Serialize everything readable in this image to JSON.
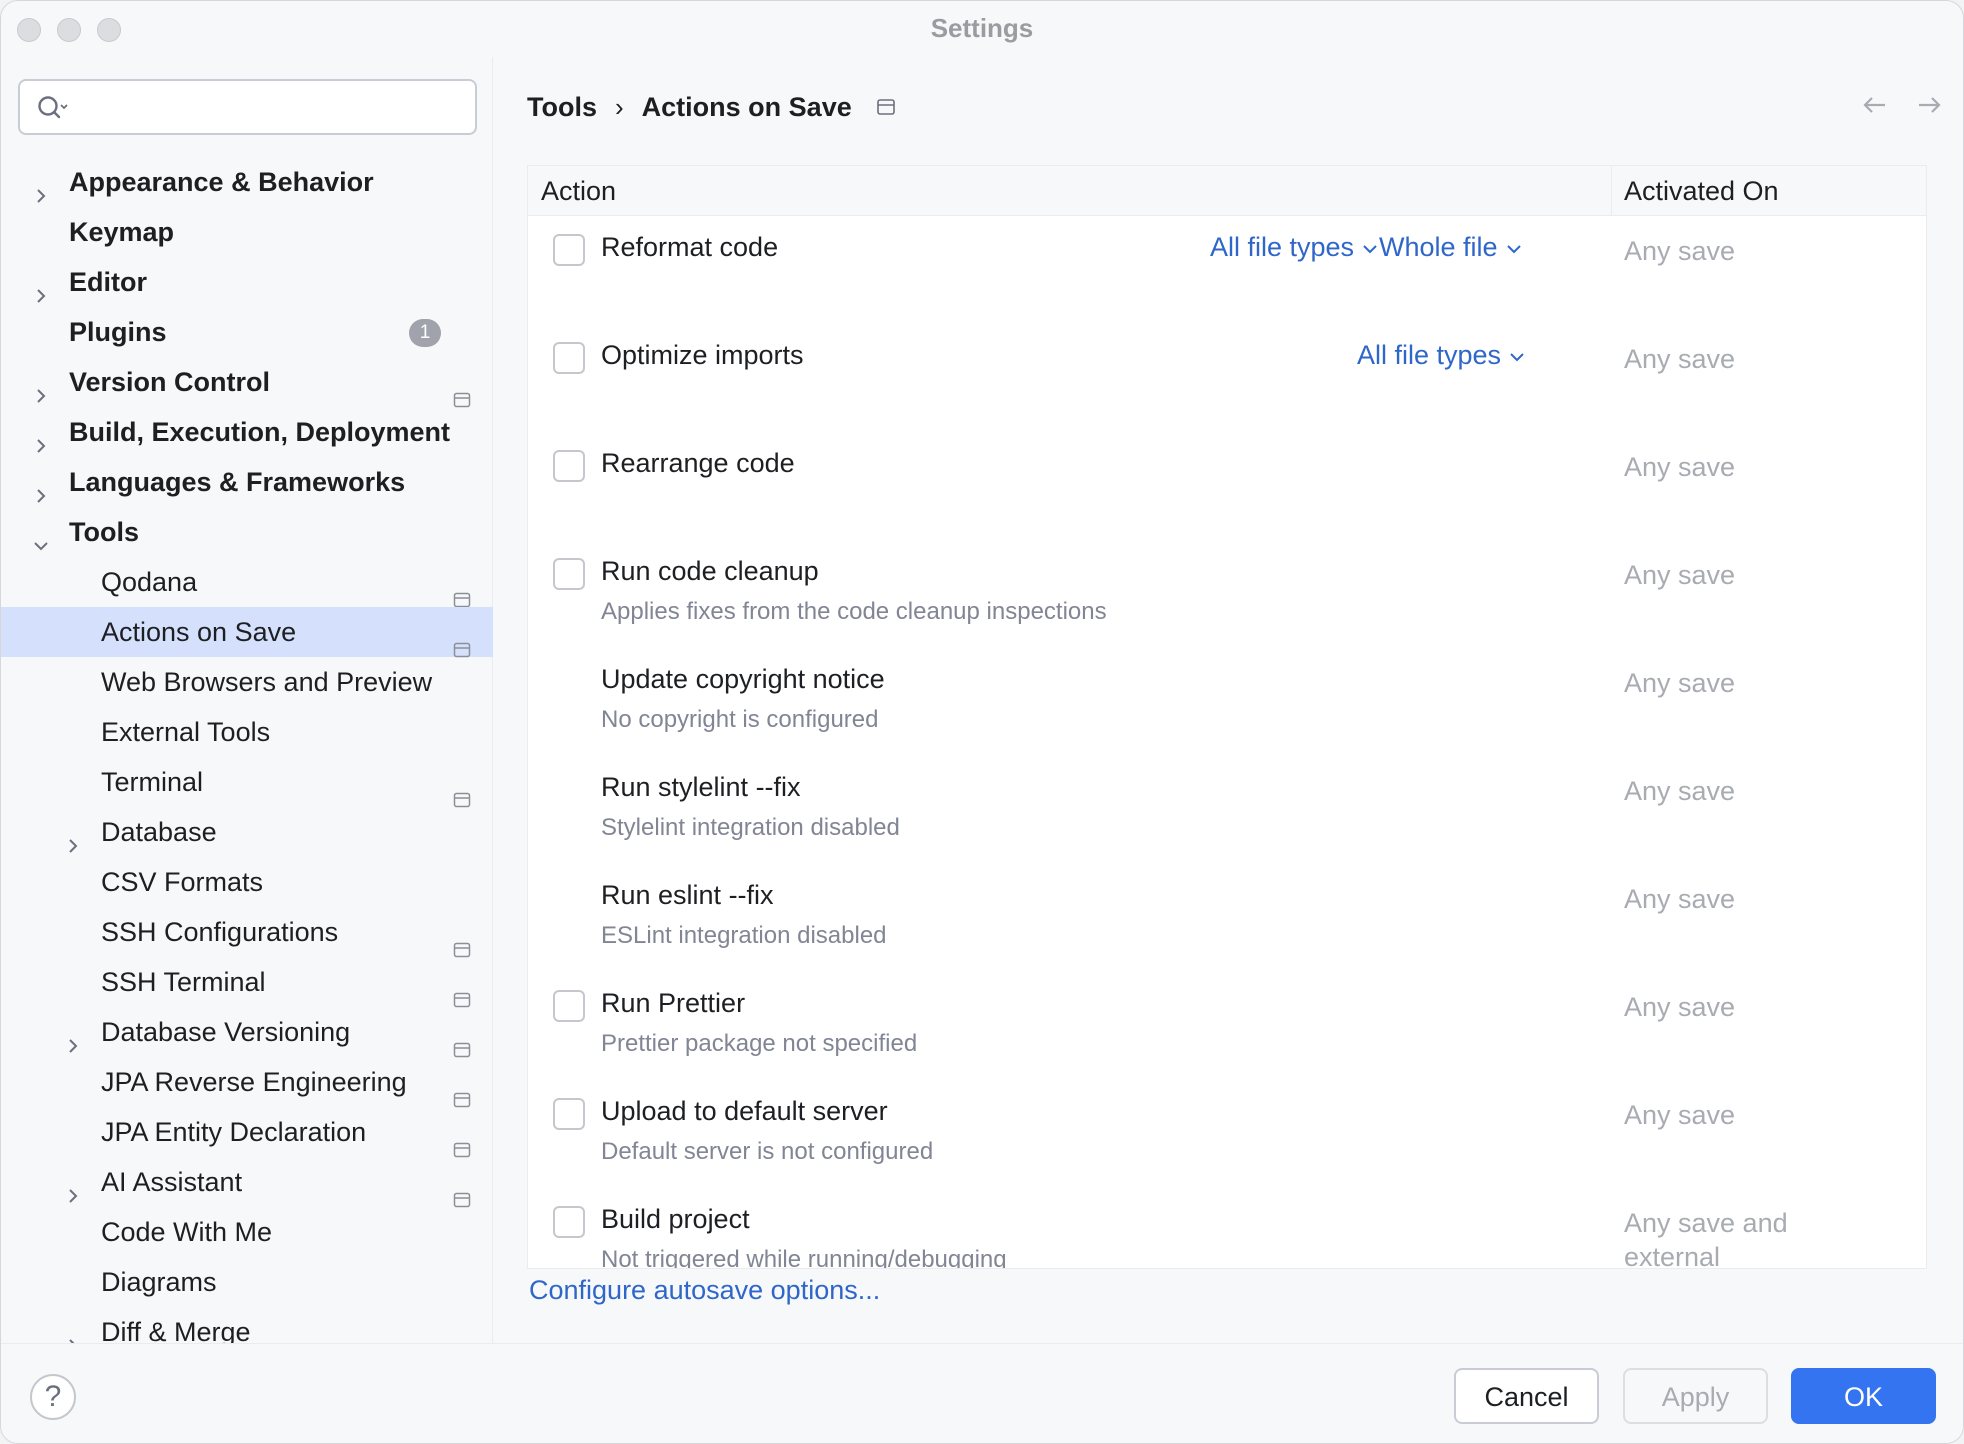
{
  "window": {
    "title": "Settings"
  },
  "search": {
    "placeholder": "",
    "value": ""
  },
  "sidebar": {
    "items": [
      {
        "label": "Appearance & Behavior",
        "level": 0,
        "expandable": true,
        "expanded": false
      },
      {
        "label": "Keymap",
        "level": 0,
        "expandable": false
      },
      {
        "label": "Editor",
        "level": 0,
        "expandable": true,
        "expanded": false
      },
      {
        "label": "Plugins",
        "level": 0,
        "expandable": false,
        "badge": "1"
      },
      {
        "label": "Version Control",
        "level": 0,
        "expandable": true,
        "expanded": false,
        "project_icon": true
      },
      {
        "label": "Build, Execution, Deployment",
        "level": 0,
        "expandable": true,
        "expanded": false
      },
      {
        "label": "Languages & Frameworks",
        "level": 0,
        "expandable": true,
        "expanded": false
      },
      {
        "label": "Tools",
        "level": 0,
        "expandable": true,
        "expanded": true
      },
      {
        "label": "Qodana",
        "level": 1,
        "project_icon": true
      },
      {
        "label": "Actions on Save",
        "level": 1,
        "project_icon": true,
        "selected": true
      },
      {
        "label": "Web Browsers and Preview",
        "level": 1
      },
      {
        "label": "External Tools",
        "level": 1
      },
      {
        "label": "Terminal",
        "level": 1,
        "project_icon": true
      },
      {
        "label": "Database",
        "level": 1,
        "expandable": true
      },
      {
        "label": "CSV Formats",
        "level": 1
      },
      {
        "label": "SSH Configurations",
        "level": 1,
        "project_icon": true
      },
      {
        "label": "SSH Terminal",
        "level": 1,
        "project_icon": true
      },
      {
        "label": "Database Versioning",
        "level": 1,
        "expandable": true,
        "project_icon": true
      },
      {
        "label": "JPA Reverse Engineering",
        "level": 1,
        "project_icon": true
      },
      {
        "label": "JPA Entity Declaration",
        "level": 1,
        "project_icon": true
      },
      {
        "label": "AI Assistant",
        "level": 1,
        "expandable": true,
        "project_icon": true
      },
      {
        "label": "Code With Me",
        "level": 1
      },
      {
        "label": "Diagrams",
        "level": 1
      },
      {
        "label": "Diff & Merge",
        "level": 1,
        "expandable": true
      }
    ]
  },
  "breadcrumb": {
    "parent": "Tools",
    "separator": "›",
    "current": "Actions on Save"
  },
  "table": {
    "headers": {
      "action": "Action",
      "activated_on": "Activated On"
    },
    "rows": [
      {
        "title": "Reformat code",
        "subtitle": "",
        "checkbox": true,
        "checked": false,
        "activated_on": "Any save",
        "dropdowns": [
          "All file types",
          "Whole file"
        ]
      },
      {
        "title": "Optimize imports",
        "subtitle": "",
        "checkbox": true,
        "checked": false,
        "activated_on": "Any save",
        "dropdowns": [
          "All file types"
        ]
      },
      {
        "title": "Rearrange code",
        "subtitle": "",
        "checkbox": true,
        "checked": false,
        "activated_on": "Any save"
      },
      {
        "title": "Run code cleanup",
        "subtitle": "Applies fixes from the code cleanup inspections",
        "checkbox": true,
        "checked": false,
        "activated_on": "Any save"
      },
      {
        "title": "Update copyright notice",
        "subtitle": "No copyright is configured",
        "checkbox": false,
        "activated_on": "Any save"
      },
      {
        "title": "Run stylelint --fix",
        "subtitle": "Stylelint integration disabled",
        "checkbox": false,
        "activated_on": "Any save"
      },
      {
        "title": "Run eslint --fix",
        "subtitle": "ESLint integration disabled",
        "checkbox": false,
        "activated_on": "Any save"
      },
      {
        "title": "Run Prettier",
        "subtitle": "Prettier package not specified",
        "checkbox": true,
        "checked": false,
        "activated_on": "Any save"
      },
      {
        "title": "Upload to default server",
        "subtitle": "Default server is not configured",
        "checkbox": true,
        "checked": false,
        "activated_on": "Any save"
      },
      {
        "title": "Build project",
        "subtitle": "Not triggered while running/debugging",
        "checkbox": true,
        "checked": false,
        "activated_on": "Any save and external change"
      }
    ]
  },
  "link": {
    "label": "Configure autosave options..."
  },
  "footer": {
    "help": "?",
    "cancel": "Cancel",
    "apply": "Apply",
    "ok": "OK"
  },
  "colors": {
    "accent": "#3574f0",
    "link": "#2e66c9",
    "selection": "#d5e1fc",
    "muted": "#a8abb2"
  }
}
